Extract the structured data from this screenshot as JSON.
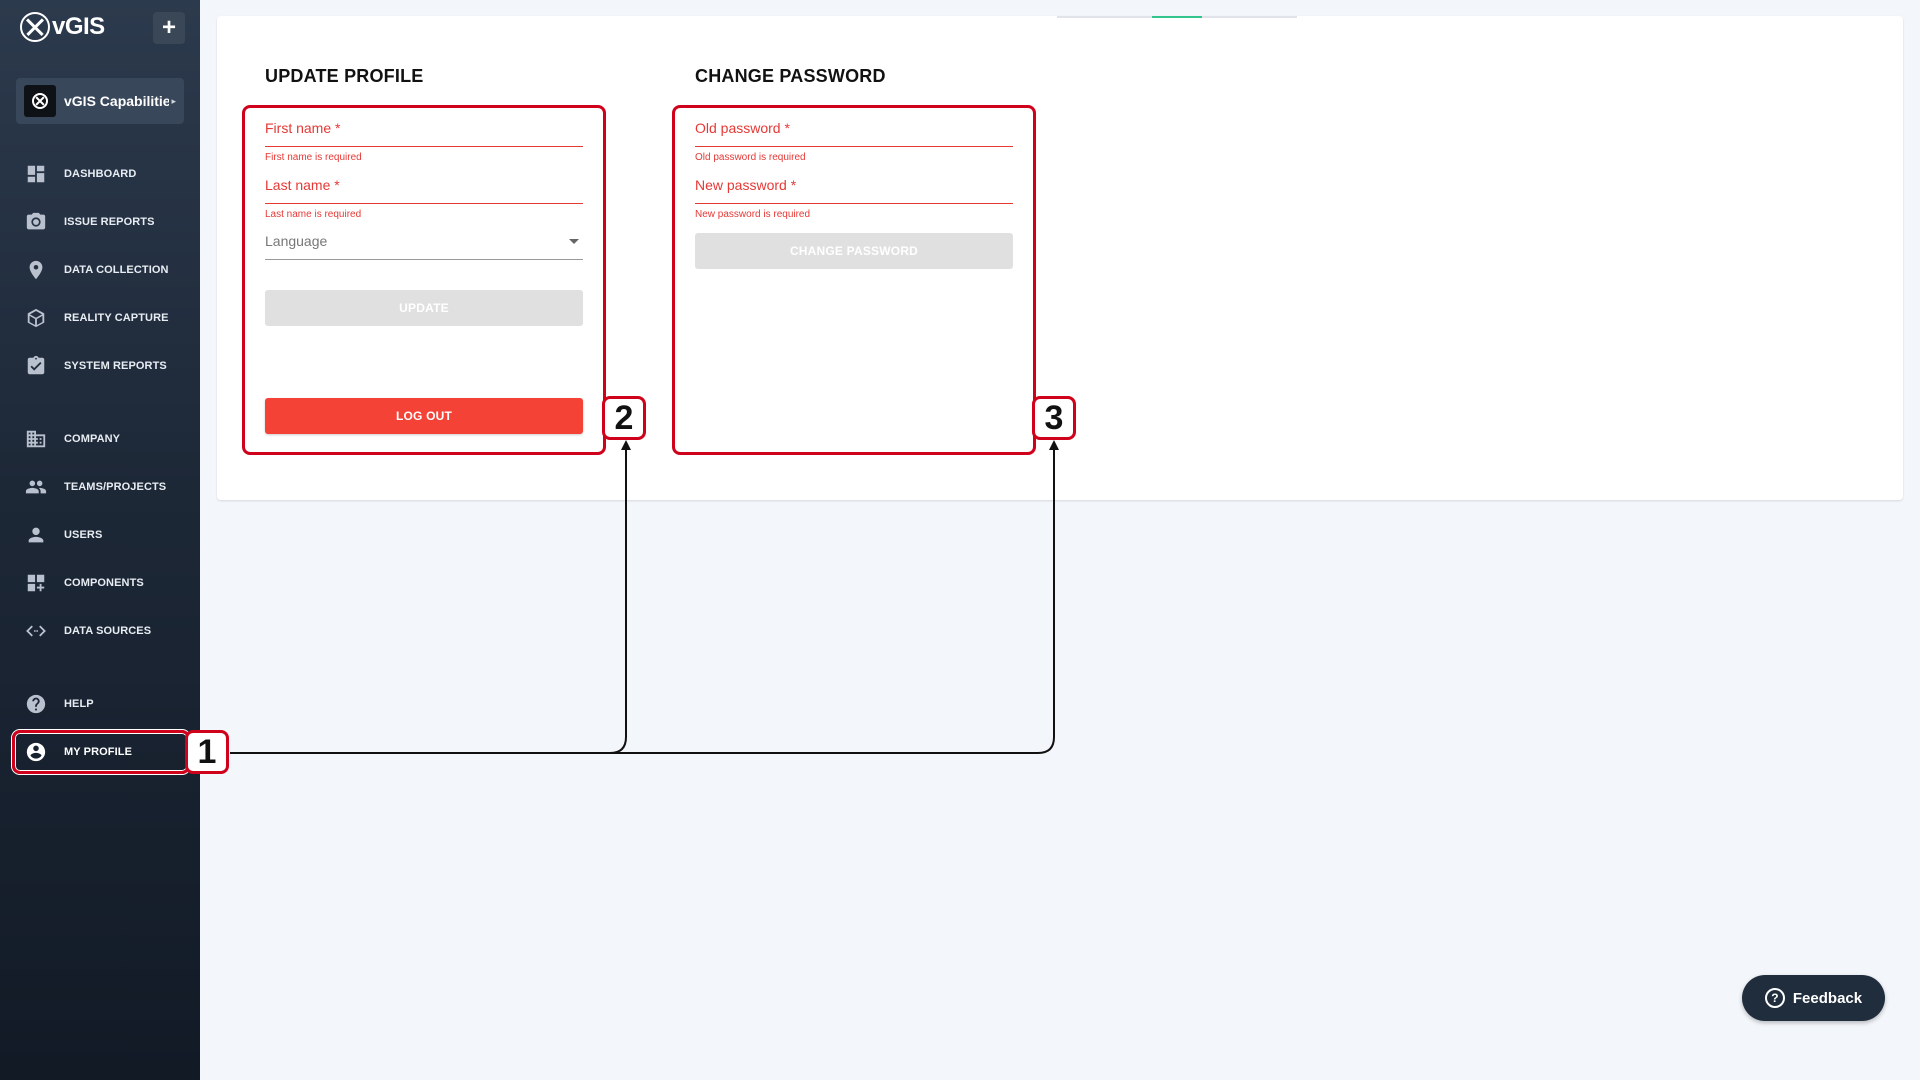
{
  "app": {
    "logo_text": "vGIS",
    "add_label": "+",
    "project_name": "vGIS Capabilities",
    "project_caret": "▸"
  },
  "sidebar": {
    "items": [
      {
        "label": "DASHBOARD",
        "icon": "dashboard-icon"
      },
      {
        "label": "ISSUE REPORTS",
        "icon": "camera-icon"
      },
      {
        "label": "DATA COLLECTION",
        "icon": "location-pin-icon"
      },
      {
        "label": "REALITY CAPTURE",
        "icon": "cube-scan-icon"
      },
      {
        "label": "SYSTEM REPORTS",
        "icon": "clipboard-check-icon"
      },
      {
        "label": "COMPANY",
        "icon": "building-icon"
      },
      {
        "label": "TEAMS/PROJECTS",
        "icon": "people-icon"
      },
      {
        "label": "USERS",
        "icon": "person-icon"
      },
      {
        "label": "COMPONENTS",
        "icon": "widgets-icon"
      },
      {
        "label": "DATA SOURCES",
        "icon": "code-brackets-icon"
      },
      {
        "label": "HELP",
        "icon": "help-circle-icon"
      },
      {
        "label": "MY PROFILE",
        "icon": "account-circle-icon",
        "active": true
      }
    ]
  },
  "update_profile": {
    "title": "UPDATE PROFILE",
    "first_name_label": "First name *",
    "first_name_error": "First name is required",
    "last_name_label": "Last name *",
    "last_name_error": "Last name is required",
    "language_placeholder": "Language",
    "update_label": "UPDATE",
    "logout_label": "LOG OUT"
  },
  "change_password": {
    "title": "CHANGE PASSWORD",
    "old_password_label": "Old password *",
    "old_password_error": "Old password is required",
    "new_password_label": "New password *",
    "new_password_error": "New password is required",
    "submit_label": "CHANGE PASSWORD"
  },
  "annotations": {
    "badge_1": "1",
    "badge_2": "2",
    "badge_3": "3",
    "color": "#d0021b"
  },
  "feedback": {
    "label": "Feedback",
    "icon_glyph": "?"
  },
  "colors": {
    "error": "#e53935",
    "danger_button": "#f44336",
    "sidebar_top": "#2c3a4d",
    "sidebar_bottom": "#121a26"
  }
}
